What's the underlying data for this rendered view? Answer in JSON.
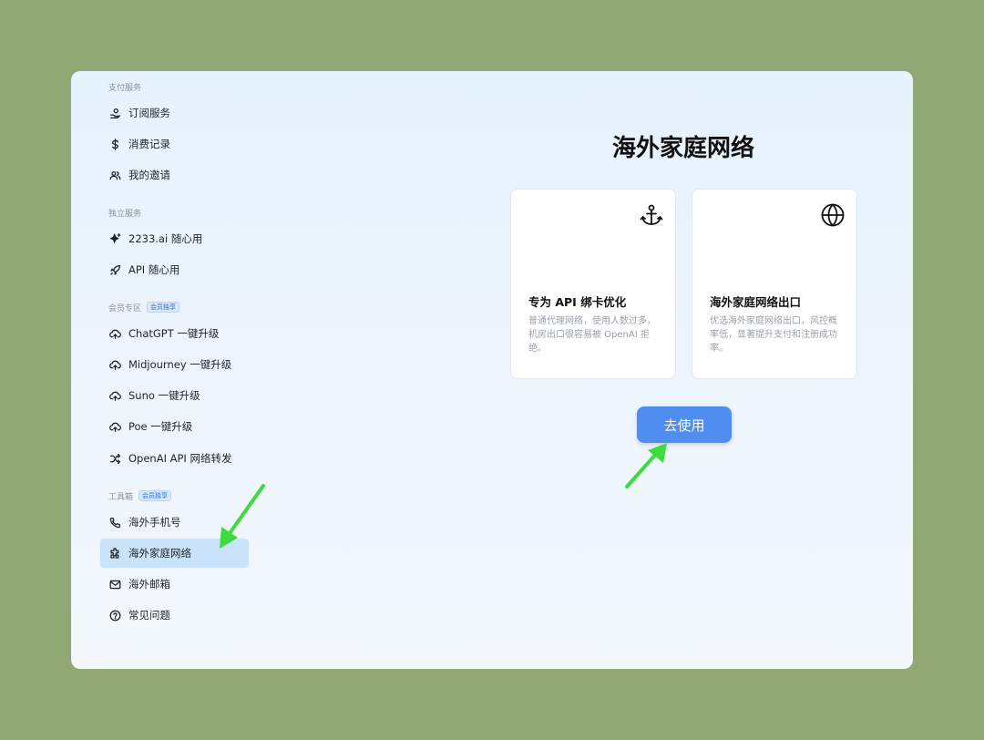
{
  "sidebar": {
    "sections": [
      {
        "label": "支付服务",
        "badge": ""
      },
      {
        "label": "独立服务",
        "badge": ""
      },
      {
        "label": "会员专区",
        "badge": "会员独享"
      },
      {
        "label": "工具箱",
        "badge": "会员独享"
      }
    ],
    "items": [
      {
        "label": "订阅服务",
        "icon": "hand-coin-icon"
      },
      {
        "label": "消费记录",
        "icon": "dollar-icon"
      },
      {
        "label": "我的邀请",
        "icon": "users-icon"
      },
      {
        "label": "2233.ai 随心用",
        "icon": "sparkle-icon"
      },
      {
        "label": "API 随心用",
        "icon": "rocket-icon"
      },
      {
        "label": "ChatGPT 一键升级",
        "icon": "cloud-upload-icon"
      },
      {
        "label": "Midjourney 一键升级",
        "icon": "cloud-upload-icon"
      },
      {
        "label": "Suno 一键升级",
        "icon": "cloud-upload-icon"
      },
      {
        "label": "Poe 一键升级",
        "icon": "cloud-upload-icon"
      },
      {
        "label": "OpenAI API 网络转发",
        "icon": "shuffle-icon"
      },
      {
        "label": "海外手机号",
        "icon": "phone-icon"
      },
      {
        "label": "海外家庭网络",
        "icon": "puzzle-icon"
      },
      {
        "label": "海外邮箱",
        "icon": "mail-icon"
      },
      {
        "label": "常见问题",
        "icon": "help-circle-icon"
      }
    ]
  },
  "main": {
    "title": "海外家庭网络",
    "cards": [
      {
        "title": "专为 API 绑卡优化",
        "description": "普通代理网络，使用人数过多，机房出口很容易被 OpenAI 拒绝。",
        "icon": "anchor-icon"
      },
      {
        "title": "海外家庭网络出口",
        "description": "优选海外家庭网络出口，风控概率低，显著提升支付和注册成功率。",
        "icon": "globe-icon"
      }
    ],
    "use_button": "去使用"
  },
  "colors": {
    "backdrop": "#8fa874",
    "active_item": "#c9e3fb",
    "button": "#4f8ef0",
    "arrow": "#3ddc3d"
  }
}
